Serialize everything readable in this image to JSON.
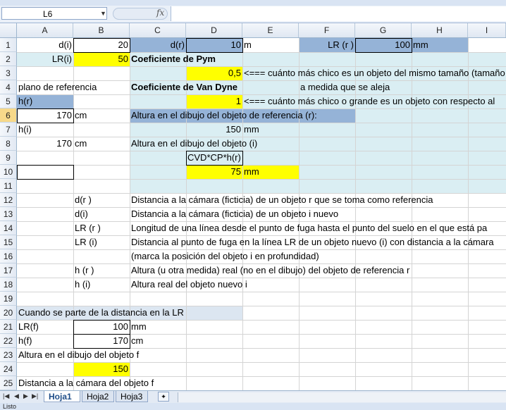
{
  "formula_bar": {
    "name_box": "L6",
    "fx": "fx",
    "formula": ""
  },
  "columns": [
    "A",
    "B",
    "C",
    "D",
    "E",
    "F",
    "G",
    "H",
    "I"
  ],
  "rows": [
    "1",
    "2",
    "3",
    "4",
    "5",
    "6",
    "7",
    "8",
    "9",
    "10",
    "11",
    "12",
    "13",
    "14",
    "15",
    "16",
    "17",
    "18",
    "19",
    "20",
    "21",
    "22",
    "23",
    "24",
    "25"
  ],
  "cells": {
    "A1": "d(i)",
    "B1": "20",
    "C1": "d(r)",
    "D1": "10",
    "E1": "m",
    "F1": "LR (r )",
    "G1": "100",
    "H1": "mm",
    "A2": "LR(i)",
    "B2": "50",
    "C2": "Coeficiente de Pym",
    "D3": "0,5",
    "E3": "<=== cuánto más chico es un objeto del mismo tamaño (tamaño",
    "A4": "plano de referencia",
    "C4": "Coeficiente de Van Dyne",
    "F4": "a medida que se aleja",
    "A5": "h(r)",
    "D5": "1",
    "E5": "<=== cuánto más chico o grande es un objeto con respecto al",
    "A6": "170",
    "B6": "cm",
    "C6": "Altura en el dibujo del objeto de referencia (r):",
    "A7": "h(i)",
    "D7": "150",
    "E7": "mm",
    "A8": "170",
    "B8": "cm",
    "C8": "Altura en el dibujo del objeto (i)",
    "D9": "CVD*CP*h(r)",
    "D10": "75",
    "E10": "mm",
    "B12": "d(r )",
    "C12": "Distancia a la cámara (ficticia) de un objeto r que se toma como referencia",
    "B13": "d(i)",
    "C13": "Distancia a la cámara (ficticia) de un objeto i nuevo",
    "B14": "LR (r )",
    "C14": "Longitud de una línea desde el punto de fuga hasta el punto del suelo en el que está pa",
    "B15": "LR (i)",
    "C15": "Distancia al punto de fuga en la línea LR de un objeto nuevo (i) con distancia a la cámara",
    "C16": "(marca la posición del objeto i en profundidad)",
    "B17": "h (r )",
    "C17": "Altura (u otra medida) real (no en el dibujo) del objeto de referencia r",
    "B18": "h (i)",
    "C18": "Altura real del objeto nuevo i",
    "A20": "Cuando se parte de la distancia en la LR",
    "A21": "LR(f)",
    "B21": "100",
    "C21": "mm",
    "A22": "h(f)",
    "B22": "170",
    "C22": "cm",
    "A23": "Altura en el dibujo del objeto f",
    "B24": "150",
    "A25": "Distancia a la cámara del objeto f"
  },
  "sheet_tabs": [
    "Hoja1",
    "Hoja2",
    "Hoja3"
  ],
  "status": "Listo",
  "colors": {
    "yellow": "#ffff00",
    "light_blue": "#daeef3",
    "medium_blue": "#95b3d7",
    "pale_blue": "#dce6f1"
  }
}
